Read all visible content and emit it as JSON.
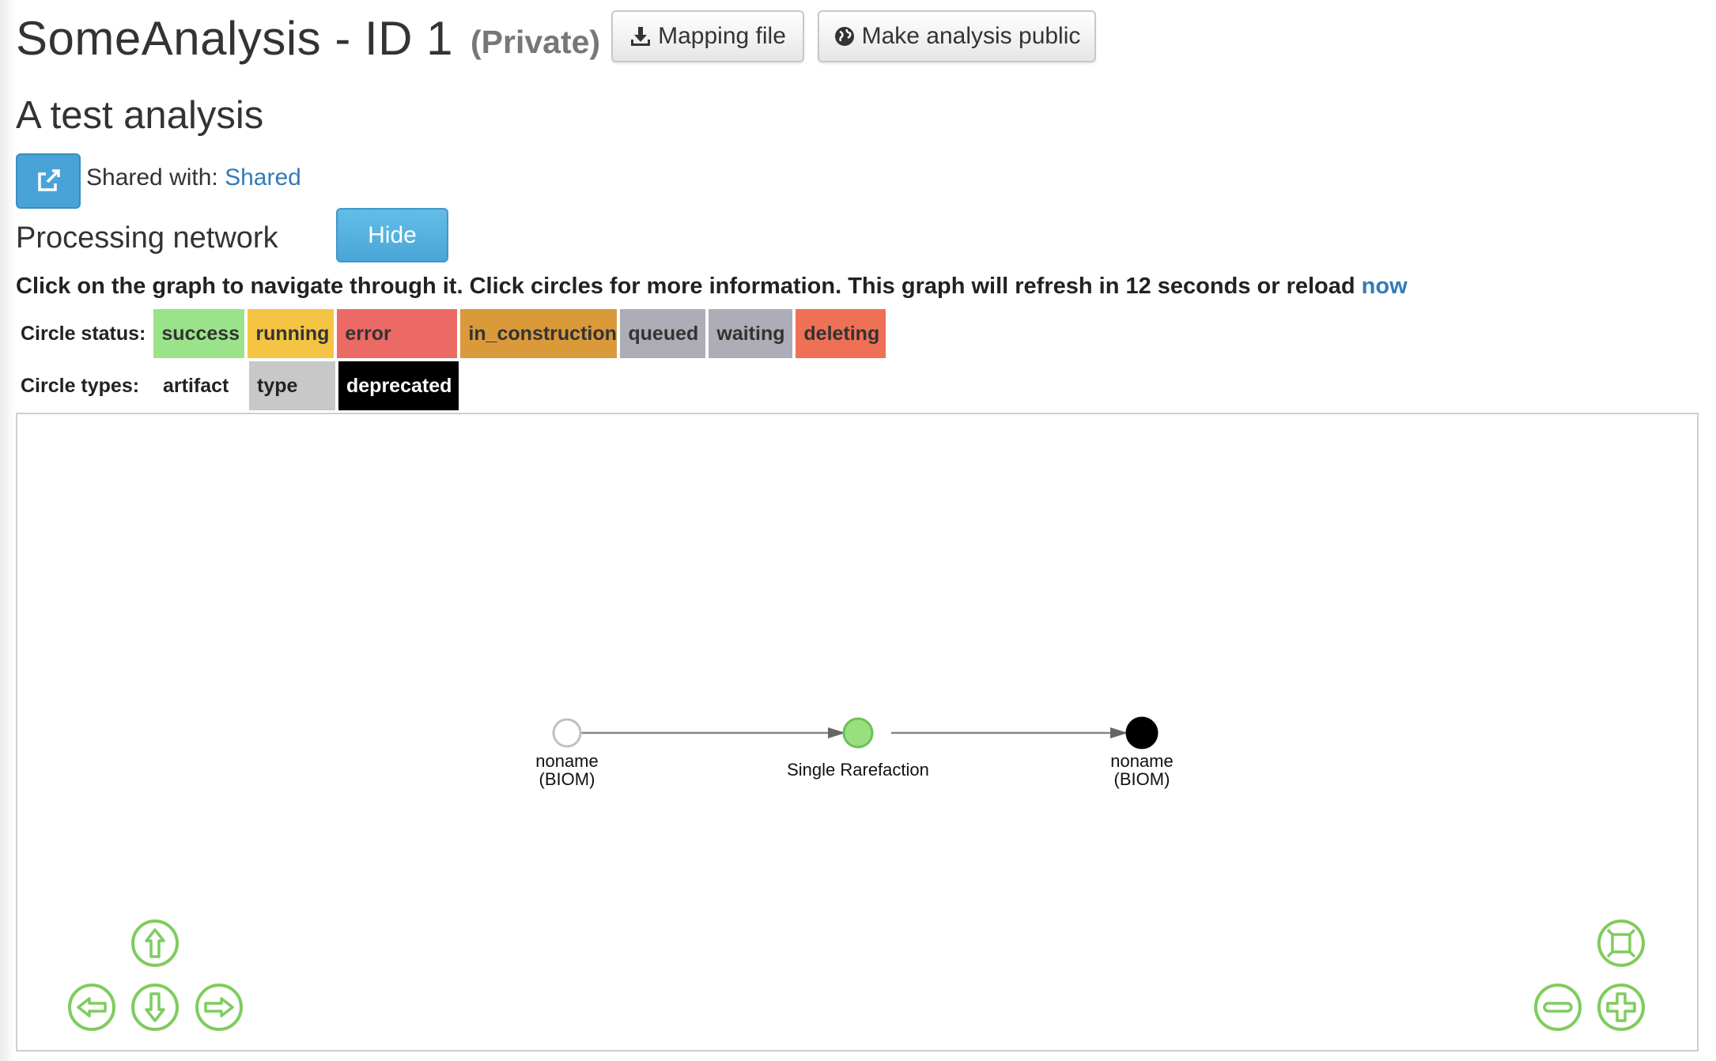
{
  "header": {
    "title": "SomeAnalysis - ID 1",
    "privacy": "(Private)",
    "mapping_button": "Mapping file",
    "public_button": "Make analysis public"
  },
  "analysis": {
    "description": "A test analysis",
    "shared_label": "Shared with:",
    "shared_link": "Shared"
  },
  "network": {
    "title": "Processing network",
    "hide_button": "Hide",
    "instructions": "Click on the graph to navigate through it. Click circles for more information. This graph will refresh in 12 seconds or reload",
    "reload_link": "now"
  },
  "legend": {
    "status_label": "Circle status:",
    "statuses": [
      {
        "label": "success",
        "color": "#9be38a"
      },
      {
        "label": "running",
        "color": "#f5c444"
      },
      {
        "label": "error",
        "color": "#ec6a65"
      },
      {
        "label": "in_construction",
        "color": "#da9a3a"
      },
      {
        "label": "queued",
        "color": "#adadb8"
      },
      {
        "label": "waiting",
        "color": "#adadb8"
      },
      {
        "label": "deleting",
        "color": "#ee7156"
      }
    ],
    "types_label": "Circle types:",
    "types": [
      {
        "label": "artifact",
        "color": "#ffffff",
        "text_color": "#222"
      },
      {
        "label": "type",
        "color": "#c8c8c8",
        "text_color": "#222"
      },
      {
        "label": "deprecated",
        "color": "#000000",
        "text_color": "#ffffff"
      }
    ]
  },
  "graph": {
    "nodes": [
      {
        "name": "input-artifact-node",
        "label1": "noname",
        "label2": "(BIOM)",
        "fill": "#ffffff",
        "stroke": "#c0c0c0"
      },
      {
        "name": "job-node",
        "label1": "Single Rarefaction",
        "label2": "",
        "fill": "#98e07e",
        "stroke": "#6cc05a"
      },
      {
        "name": "output-artifact-node",
        "label1": "noname",
        "label2": "(BIOM)",
        "fill": "#000000",
        "stroke": "#000000"
      }
    ],
    "controls": [
      "pan-up",
      "pan-left",
      "pan-down",
      "pan-right",
      "fit",
      "zoom-out",
      "zoom-in"
    ],
    "control_color": "#7fcc5f"
  }
}
